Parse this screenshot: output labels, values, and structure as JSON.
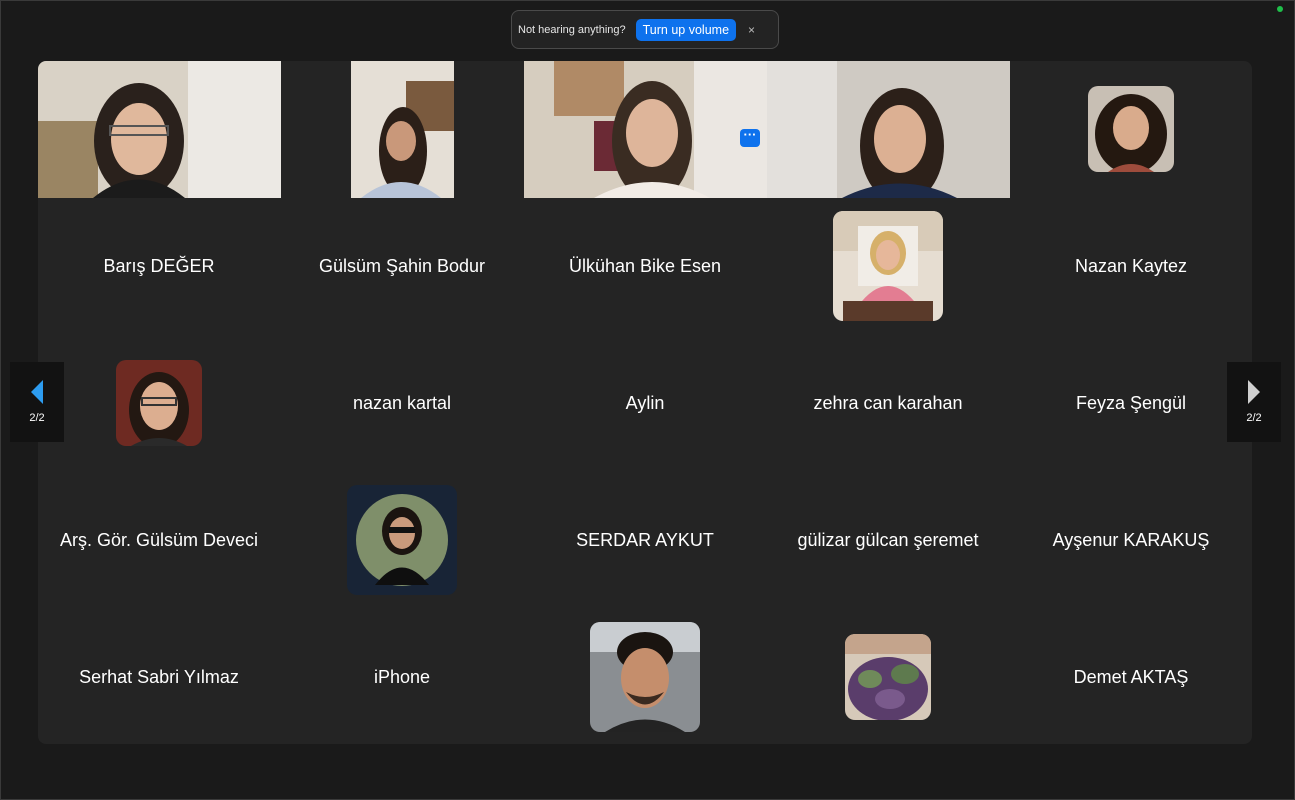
{
  "notification": {
    "message": "Not hearing anything?",
    "action_label": "Turn up volume",
    "close_glyph": "×"
  },
  "more_glyph": "···",
  "pagination": {
    "prev_label": "2/2",
    "next_label": "2/2",
    "prev_color": "#2d9cf0",
    "next_color": "#d0d0d0"
  },
  "participants": [
    "Barış DEĞER",
    "Gülsüm Şahin Bodur",
    "Ülkühan Bike Esen",
    "Nazan Kaytez",
    "nazan kartal",
    "Aylin",
    "zehra can karahan",
    "Feyza Şengül",
    "Arş. Gör. Gülsüm Deveci",
    "SERDAR AYKUT",
    "gülizar gülcan şeremet",
    "Ayşenur KARAKUŞ",
    "Serhat Sabri Yılmaz",
    "iPhone",
    "Demet AKTAŞ"
  ],
  "colors": {
    "background": "#1a1a1a",
    "panel": "#242424",
    "accent": "#0e72ed",
    "status": "#1fbf4a"
  }
}
